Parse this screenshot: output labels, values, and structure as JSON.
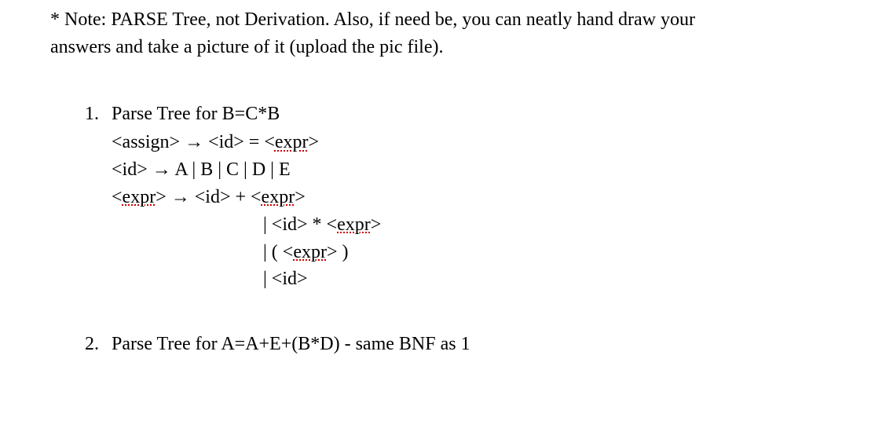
{
  "note": {
    "line1_part1": "* Note: PARSE Tree, not Derivation.  Also, if need be, you can neatly hand draw your",
    "line2": "answers and take a picture of it (upload the pic file)."
  },
  "item1": {
    "number": "1.",
    "title": "Parse Tree for B=C*B",
    "rule1_a": "<assign> → <id> = <",
    "rule1_expr": "expr",
    "rule1_b": ">",
    "rule2": "<id> → A | B | C | D | E",
    "rule3_a": "<",
    "rule3_expr1": "expr",
    "rule3_b": "> → <id> + <",
    "rule3_expr2": "expr",
    "rule3_c": ">",
    "alt1_a": "| <id> * <",
    "alt1_expr": "expr",
    "alt1_b": ">",
    "alt2_a": "| ( <",
    "alt2_expr": "expr",
    "alt2_b": "> )",
    "alt3": "| <id>"
  },
  "item2": {
    "number": "2.",
    "title": "Parse Tree for A=A+E+(B*D)   - same BNF as 1"
  }
}
